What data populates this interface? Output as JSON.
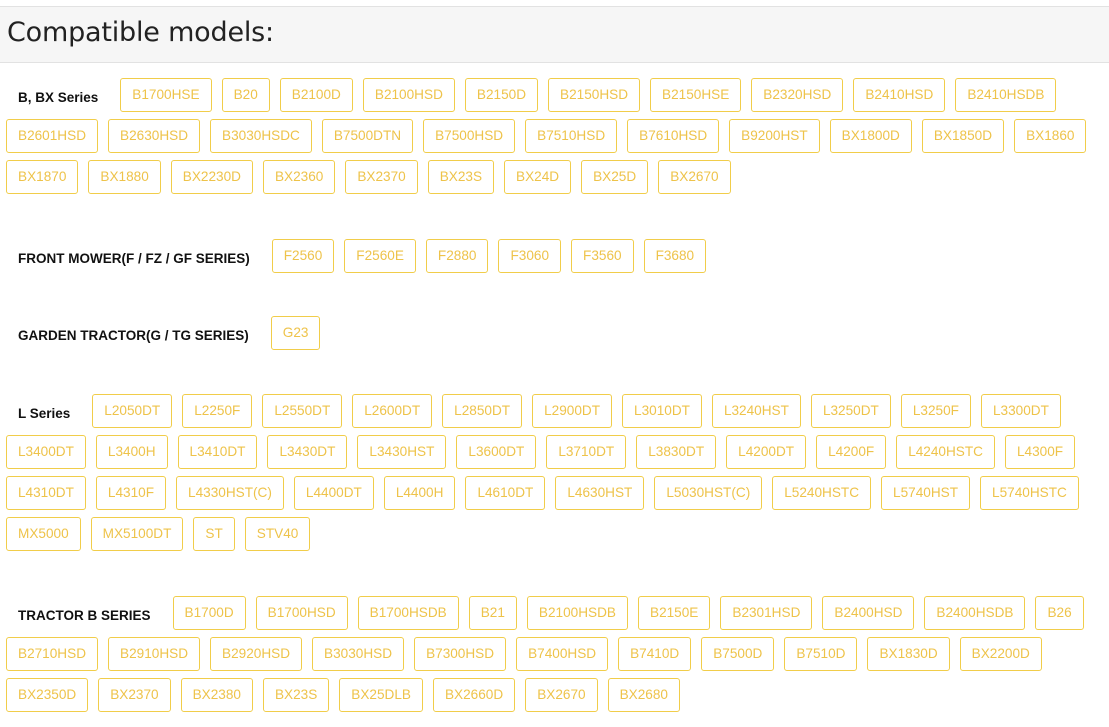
{
  "heading": "Compatible models:",
  "colors": {
    "tag_text": "#eec34a",
    "tag_border": "#f1cd4a",
    "header_bg": "#f6f6f6"
  },
  "series": [
    {
      "label": "B, BX Series",
      "models": [
        "B1700HSE",
        "B20",
        "B2100D",
        "B2100HSD",
        "B2150D",
        "B2150HSD",
        "B2150HSE",
        "B2320HSD",
        "B2410HSD",
        "B2410HSDB",
        "B2601HSD",
        "B2630HSD",
        "B3030HSDC",
        "B7500DTN",
        "B7500HSD",
        "B7510HSD",
        "B7610HSD",
        "B9200HST",
        "BX1800D",
        "BX1850D",
        "BX1860",
        "BX1870",
        "BX1880",
        "BX2230D",
        "BX2360",
        "BX2370",
        "BX23S",
        "BX24D",
        "BX25D",
        "BX2670"
      ]
    },
    {
      "label": "FRONT MOWER(F / FZ / GF SERIES)",
      "models": [
        "F2560",
        "F2560E",
        "F2880",
        "F3060",
        "F3560",
        "F3680"
      ]
    },
    {
      "label": "GARDEN TRACTOR(G / TG SERIES)",
      "models": [
        "G23"
      ]
    },
    {
      "label": "L Series",
      "models": [
        "L2050DT",
        "L2250F",
        "L2550DT",
        "L2600DT",
        "L2850DT",
        "L2900DT",
        "L3010DT",
        "L3240HST",
        "L3250DT",
        "L3250F",
        "L3300DT",
        "L3400DT",
        "L3400H",
        "L3410DT",
        "L3430DT",
        "L3430HST",
        "L3600DT",
        "L3710DT",
        "L3830DT",
        "L4200DT",
        "L4200F",
        "L4240HSTC",
        "L4300F",
        "L4310DT",
        "L4310F",
        "L4330HST(C)",
        "L4400DT",
        "L4400H",
        "L4610DT",
        "L4630HST",
        "L5030HST(C)",
        "L5240HSTC",
        "L5740HST",
        "L5740HSTC",
        "MX5000",
        "MX5100DT",
        "ST",
        "STV40"
      ]
    },
    {
      "label": "TRACTOR B SERIES",
      "models": [
        "B1700D",
        "B1700HSD",
        "B1700HSDB",
        "B21",
        "B2100HSDB",
        "B2150E",
        "B2301HSD",
        "B2400HSD",
        "B2400HSDB",
        "B26",
        "B2710HSD",
        "B2910HSD",
        "B2920HSD",
        "B3030HSD",
        "B7300HSD",
        "B7400HSD",
        "B7410D",
        "B7500D",
        "B7510D",
        "BX1830D",
        "BX2200D",
        "BX2350D",
        "BX2370",
        "BX2380",
        "BX23S",
        "BX25DLB",
        "BX2660D",
        "BX2670",
        "BX2680"
      ]
    }
  ]
}
